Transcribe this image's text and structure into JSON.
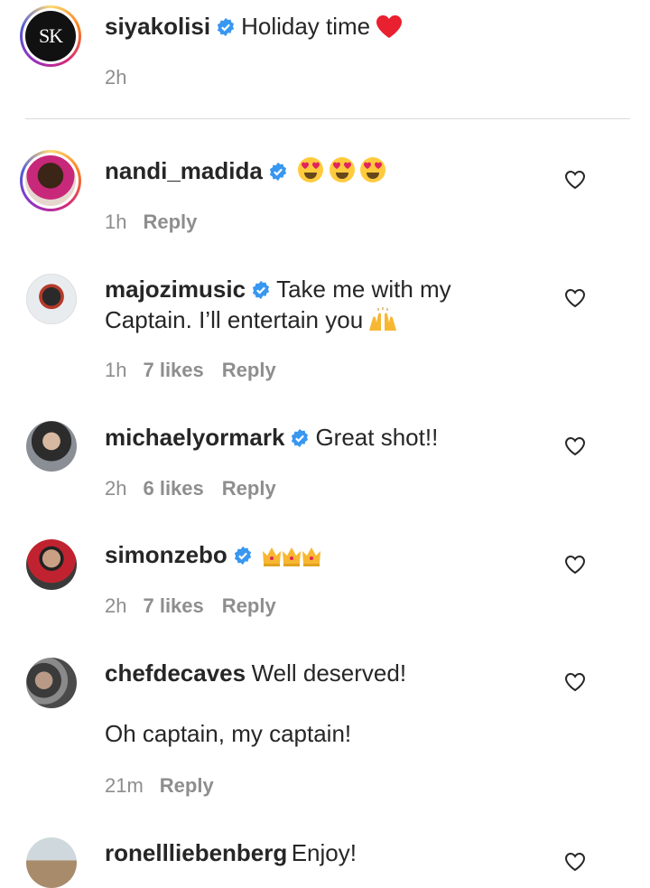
{
  "caption": {
    "username": "siyakolisi",
    "text": "Holiday time",
    "time": "2h",
    "avatar_initials": "SK"
  },
  "comments": [
    {
      "username": "nandi_madida",
      "verified": true,
      "text": "",
      "emoji": [
        "heart-eyes-emoji",
        "heart-eyes-emoji",
        "heart-eyes-emoji"
      ],
      "time": "1h",
      "likes": "",
      "reply": "Reply"
    },
    {
      "username": "majozimusic",
      "verified": true,
      "text_line1": "Take me with my",
      "text_line2": "Captain. I’ll entertain you",
      "time": "1h",
      "likes": "7 likes",
      "reply": "Reply"
    },
    {
      "username": "michaelyormark",
      "verified": true,
      "text": "Great shot!!",
      "time": "2h",
      "likes": "6 likes",
      "reply": "Reply"
    },
    {
      "username": "simonzebo",
      "verified": true,
      "text": "",
      "emoji": [
        "crown-emoji",
        "crown-emoji",
        "crown-emoji"
      ],
      "time": "2h",
      "likes": "7 likes",
      "reply": "Reply"
    },
    {
      "username": "chefdecaves",
      "verified": false,
      "text": "Well deserved!",
      "text_line2": "Oh captain, my captain!",
      "time": "21m",
      "likes": "",
      "reply": "Reply"
    },
    {
      "username": "ronellliebenberg",
      "verified": false,
      "text": "Enjoy!"
    }
  ],
  "colors": {
    "verified": "#3897f0",
    "heart_red": "#ed4956",
    "meta_gray": "#8e8e8e"
  }
}
